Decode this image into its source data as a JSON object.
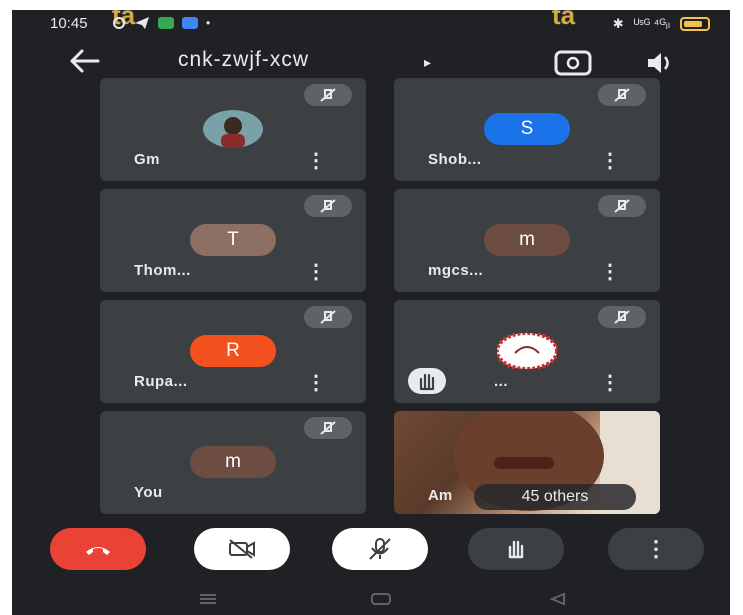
{
  "status_bar": {
    "time": "10:45",
    "signal_text": "ᵁˢᴳ ⁴ᴳᵢₗ"
  },
  "meeting": {
    "code": "cnk-zwjf-xcw",
    "caret": "▸"
  },
  "watermark": [
    "ta",
    "ta"
  ],
  "participants": [
    {
      "name": "Gm",
      "avatar_text": "",
      "avatar_color": "#7aa0a8"
    },
    {
      "name": "Shob...",
      "avatar_text": "S",
      "avatar_color": "#1a73e8"
    },
    {
      "name": "Thom...",
      "avatar_text": "T",
      "avatar_color": "#8d6e63"
    },
    {
      "name": "mgcs...",
      "avatar_text": "m",
      "avatar_color": "#6d4c41"
    },
    {
      "name": "Rupa...",
      "avatar_text": "R",
      "avatar_color": "#f4511e"
    },
    {
      "name": "...",
      "avatar_text": "",
      "avatar_color": "#d32f2f"
    },
    {
      "name": "You",
      "avatar_text": "m",
      "avatar_color": "#6d4c41"
    }
  ],
  "video_tile": {
    "name": "Am",
    "others_label": "45 others"
  },
  "controls": {
    "end_call_color": "#ea4335",
    "camera_bg": "#ffffff",
    "mic_bg": "#ffffff",
    "hand_bg": "#3c4043",
    "more_bg": "#3c4043",
    "more_label": "⋮"
  },
  "tile_more_label": "⋮",
  "nav_icons": [
    "menu-icon",
    "home-icon",
    "back-icon"
  ]
}
